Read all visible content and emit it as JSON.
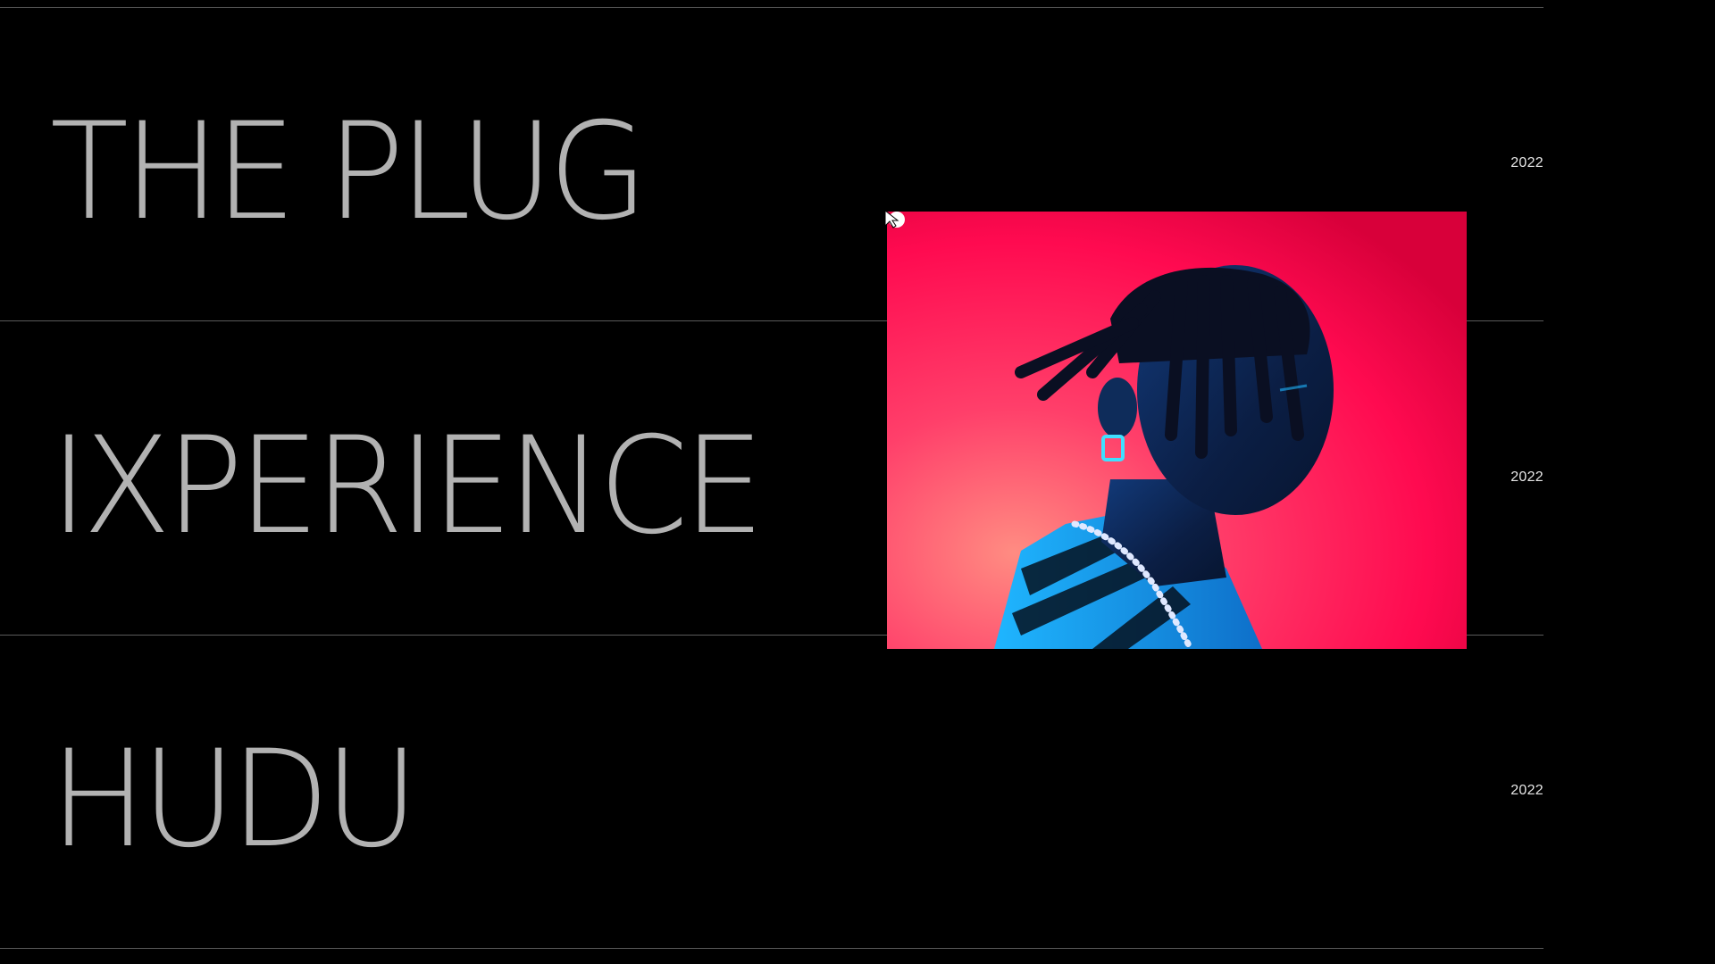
{
  "projects": [
    {
      "title": "THE PLUG",
      "year": "2022"
    },
    {
      "title": "IXPERIENCE",
      "year": "2022"
    },
    {
      "title": "HUDU",
      "year": "2022"
    }
  ],
  "preview": {
    "subject": "portrait-photo",
    "background_colors": [
      "#ff0a50",
      "#ff6f7d",
      "#e0003c"
    ],
    "highlight_color": "#1fb6ff"
  },
  "cursor": {
    "icon": "pointer-cursor-icon"
  }
}
